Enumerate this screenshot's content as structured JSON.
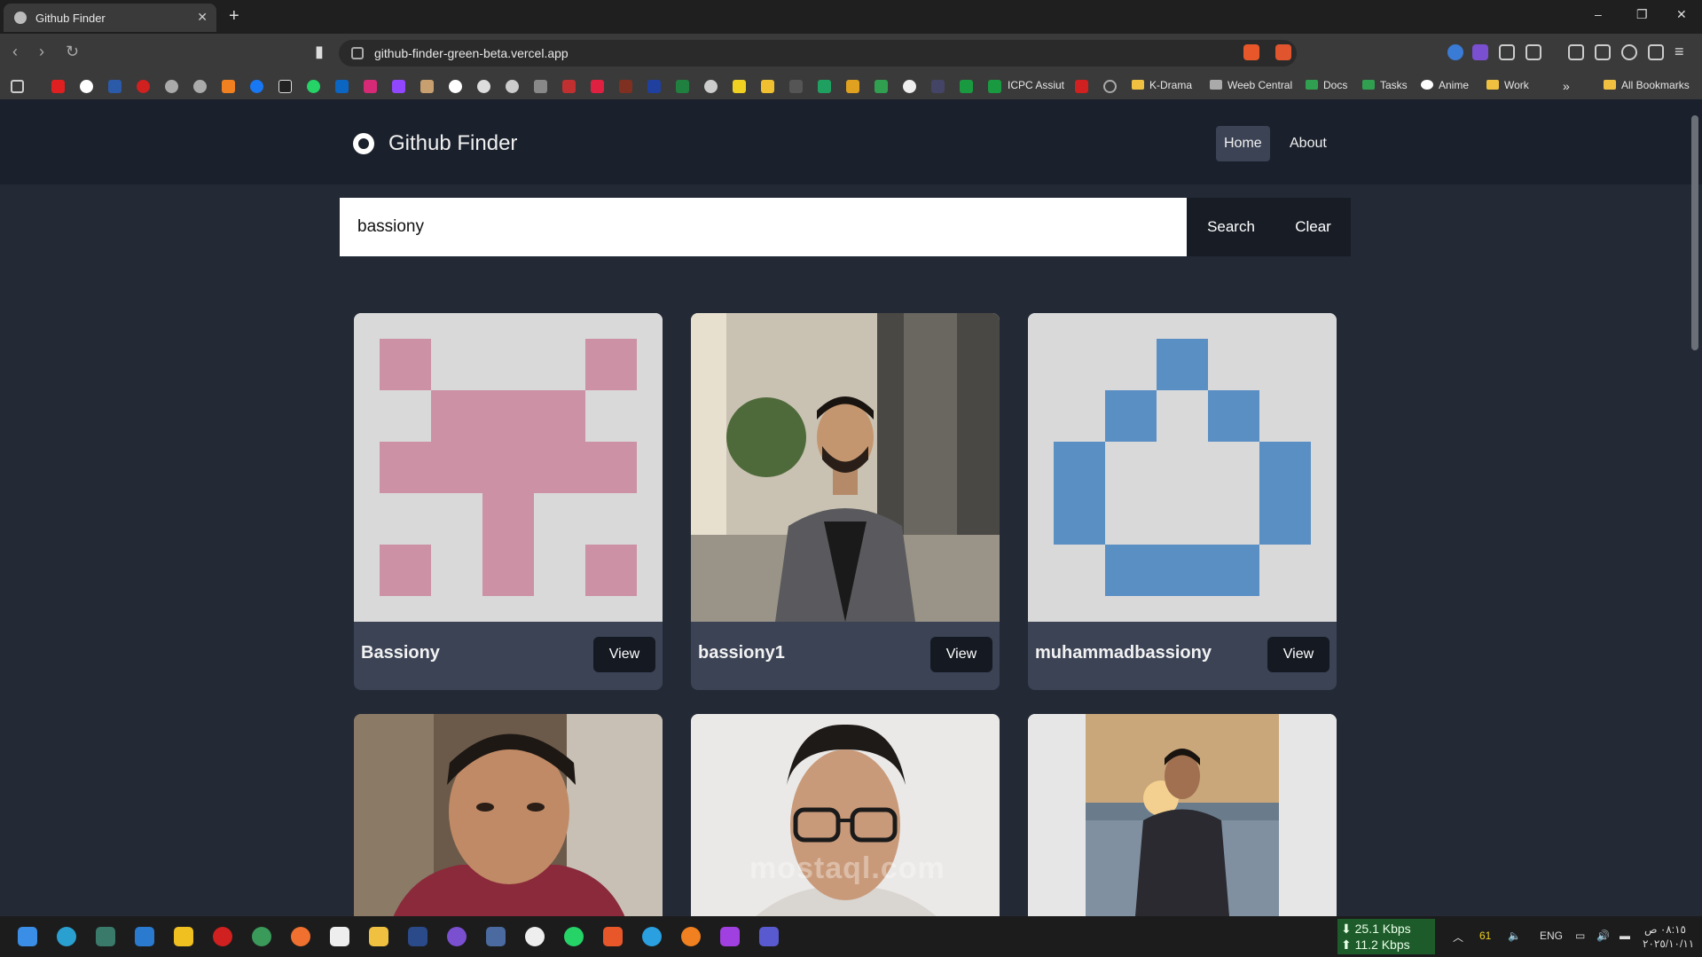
{
  "browser": {
    "tab_title": "Github Finder",
    "url": "github-finder-green-beta.vercel.app",
    "bookmarks": [
      "ICPC Assiut",
      "K-Drama",
      "Weeb Central",
      "Docs",
      "Tasks",
      "Anime",
      "Work",
      "All Bookmarks"
    ]
  },
  "app": {
    "brand": "Github Finder",
    "nav": {
      "home": "Home",
      "about": "About"
    },
    "search": {
      "value": "bassiony",
      "search_label": "Search",
      "clear_label": "Clear"
    },
    "users": [
      {
        "login": "Bassiony",
        "view": "View"
      },
      {
        "login": "bassiony1",
        "view": "View"
      },
      {
        "login": "muhammadbassiony",
        "view": "View"
      }
    ]
  },
  "watermark": "mostaql.com",
  "taskbar": {
    "down_speed": "25.1 Kbps",
    "up_speed": "11.2 Kbps",
    "lang": "ENG",
    "battery": "61",
    "time": "٠٨:١٥ ص",
    "date": "٢٠٢٥/١٠/١١"
  },
  "colors": {
    "app_bg": "#232a36",
    "nav_bg": "#1a202c",
    "card_bg": "#3b4355",
    "identicon_pink": "#cc91a4",
    "identicon_blue": "#5a8fc4"
  }
}
